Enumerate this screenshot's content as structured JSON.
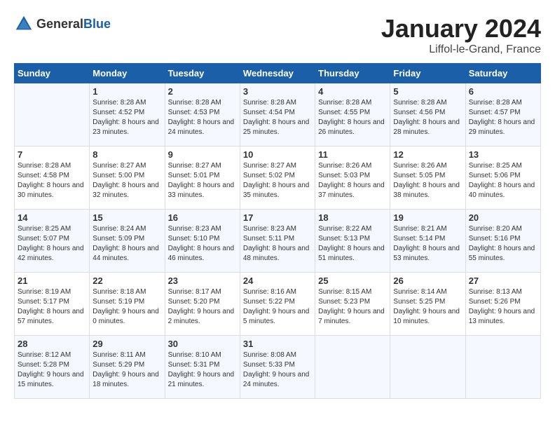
{
  "logo": {
    "general": "General",
    "blue": "Blue"
  },
  "title": "January 2024",
  "location": "Liffol-le-Grand, France",
  "weekdays": [
    "Sunday",
    "Monday",
    "Tuesday",
    "Wednesday",
    "Thursday",
    "Friday",
    "Saturday"
  ],
  "weeks": [
    [
      {
        "day": "",
        "sunrise": "",
        "sunset": "",
        "daylight": ""
      },
      {
        "day": "1",
        "sunrise": "Sunrise: 8:28 AM",
        "sunset": "Sunset: 4:52 PM",
        "daylight": "Daylight: 8 hours and 23 minutes."
      },
      {
        "day": "2",
        "sunrise": "Sunrise: 8:28 AM",
        "sunset": "Sunset: 4:53 PM",
        "daylight": "Daylight: 8 hours and 24 minutes."
      },
      {
        "day": "3",
        "sunrise": "Sunrise: 8:28 AM",
        "sunset": "Sunset: 4:54 PM",
        "daylight": "Daylight: 8 hours and 25 minutes."
      },
      {
        "day": "4",
        "sunrise": "Sunrise: 8:28 AM",
        "sunset": "Sunset: 4:55 PM",
        "daylight": "Daylight: 8 hours and 26 minutes."
      },
      {
        "day": "5",
        "sunrise": "Sunrise: 8:28 AM",
        "sunset": "Sunset: 4:56 PM",
        "daylight": "Daylight: 8 hours and 28 minutes."
      },
      {
        "day": "6",
        "sunrise": "Sunrise: 8:28 AM",
        "sunset": "Sunset: 4:57 PM",
        "daylight": "Daylight: 8 hours and 29 minutes."
      }
    ],
    [
      {
        "day": "7",
        "sunrise": "Sunrise: 8:28 AM",
        "sunset": "Sunset: 4:58 PM",
        "daylight": "Daylight: 8 hours and 30 minutes."
      },
      {
        "day": "8",
        "sunrise": "Sunrise: 8:27 AM",
        "sunset": "Sunset: 5:00 PM",
        "daylight": "Daylight: 8 hours and 32 minutes."
      },
      {
        "day": "9",
        "sunrise": "Sunrise: 8:27 AM",
        "sunset": "Sunset: 5:01 PM",
        "daylight": "Daylight: 8 hours and 33 minutes."
      },
      {
        "day": "10",
        "sunrise": "Sunrise: 8:27 AM",
        "sunset": "Sunset: 5:02 PM",
        "daylight": "Daylight: 8 hours and 35 minutes."
      },
      {
        "day": "11",
        "sunrise": "Sunrise: 8:26 AM",
        "sunset": "Sunset: 5:03 PM",
        "daylight": "Daylight: 8 hours and 37 minutes."
      },
      {
        "day": "12",
        "sunrise": "Sunrise: 8:26 AM",
        "sunset": "Sunset: 5:05 PM",
        "daylight": "Daylight: 8 hours and 38 minutes."
      },
      {
        "day": "13",
        "sunrise": "Sunrise: 8:25 AM",
        "sunset": "Sunset: 5:06 PM",
        "daylight": "Daylight: 8 hours and 40 minutes."
      }
    ],
    [
      {
        "day": "14",
        "sunrise": "Sunrise: 8:25 AM",
        "sunset": "Sunset: 5:07 PM",
        "daylight": "Daylight: 8 hours and 42 minutes."
      },
      {
        "day": "15",
        "sunrise": "Sunrise: 8:24 AM",
        "sunset": "Sunset: 5:09 PM",
        "daylight": "Daylight: 8 hours and 44 minutes."
      },
      {
        "day": "16",
        "sunrise": "Sunrise: 8:23 AM",
        "sunset": "Sunset: 5:10 PM",
        "daylight": "Daylight: 8 hours and 46 minutes."
      },
      {
        "day": "17",
        "sunrise": "Sunrise: 8:23 AM",
        "sunset": "Sunset: 5:11 PM",
        "daylight": "Daylight: 8 hours and 48 minutes."
      },
      {
        "day": "18",
        "sunrise": "Sunrise: 8:22 AM",
        "sunset": "Sunset: 5:13 PM",
        "daylight": "Daylight: 8 hours and 51 minutes."
      },
      {
        "day": "19",
        "sunrise": "Sunrise: 8:21 AM",
        "sunset": "Sunset: 5:14 PM",
        "daylight": "Daylight: 8 hours and 53 minutes."
      },
      {
        "day": "20",
        "sunrise": "Sunrise: 8:20 AM",
        "sunset": "Sunset: 5:16 PM",
        "daylight": "Daylight: 8 hours and 55 minutes."
      }
    ],
    [
      {
        "day": "21",
        "sunrise": "Sunrise: 8:19 AM",
        "sunset": "Sunset: 5:17 PM",
        "daylight": "Daylight: 8 hours and 57 minutes."
      },
      {
        "day": "22",
        "sunrise": "Sunrise: 8:18 AM",
        "sunset": "Sunset: 5:19 PM",
        "daylight": "Daylight: 9 hours and 0 minutes."
      },
      {
        "day": "23",
        "sunrise": "Sunrise: 8:17 AM",
        "sunset": "Sunset: 5:20 PM",
        "daylight": "Daylight: 9 hours and 2 minutes."
      },
      {
        "day": "24",
        "sunrise": "Sunrise: 8:16 AM",
        "sunset": "Sunset: 5:22 PM",
        "daylight": "Daylight: 9 hours and 5 minutes."
      },
      {
        "day": "25",
        "sunrise": "Sunrise: 8:15 AM",
        "sunset": "Sunset: 5:23 PM",
        "daylight": "Daylight: 9 hours and 7 minutes."
      },
      {
        "day": "26",
        "sunrise": "Sunrise: 8:14 AM",
        "sunset": "Sunset: 5:25 PM",
        "daylight": "Daylight: 9 hours and 10 minutes."
      },
      {
        "day": "27",
        "sunrise": "Sunrise: 8:13 AM",
        "sunset": "Sunset: 5:26 PM",
        "daylight": "Daylight: 9 hours and 13 minutes."
      }
    ],
    [
      {
        "day": "28",
        "sunrise": "Sunrise: 8:12 AM",
        "sunset": "Sunset: 5:28 PM",
        "daylight": "Daylight: 9 hours and 15 minutes."
      },
      {
        "day": "29",
        "sunrise": "Sunrise: 8:11 AM",
        "sunset": "Sunset: 5:29 PM",
        "daylight": "Daylight: 9 hours and 18 minutes."
      },
      {
        "day": "30",
        "sunrise": "Sunrise: 8:10 AM",
        "sunset": "Sunset: 5:31 PM",
        "daylight": "Daylight: 9 hours and 21 minutes."
      },
      {
        "day": "31",
        "sunrise": "Sunrise: 8:08 AM",
        "sunset": "Sunset: 5:33 PM",
        "daylight": "Daylight: 9 hours and 24 minutes."
      },
      {
        "day": "",
        "sunrise": "",
        "sunset": "",
        "daylight": ""
      },
      {
        "day": "",
        "sunrise": "",
        "sunset": "",
        "daylight": ""
      },
      {
        "day": "",
        "sunrise": "",
        "sunset": "",
        "daylight": ""
      }
    ]
  ]
}
